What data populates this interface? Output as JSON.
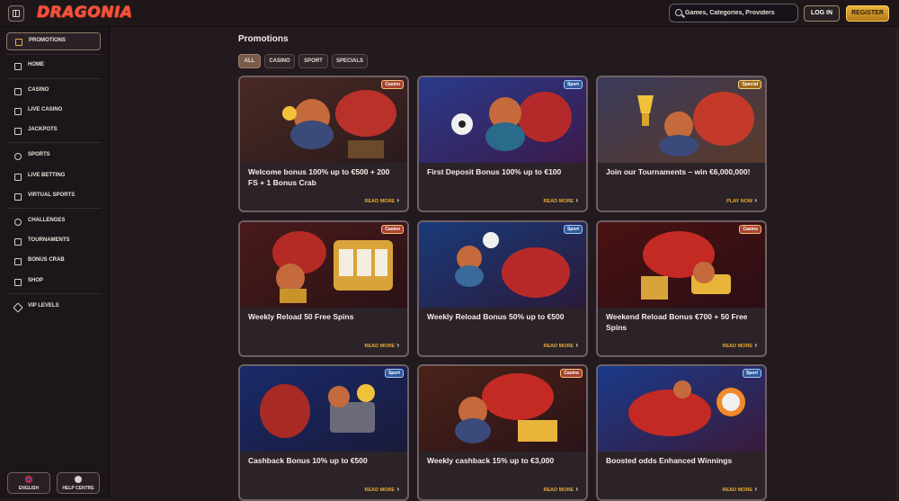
{
  "header": {
    "logo_text": "DRAGONIA",
    "search_placeholder": "Games, Categories, Providers",
    "login_label": "LOG IN",
    "register_label": "REGISTER"
  },
  "sidebar": {
    "items": [
      {
        "label": "PROMOTIONS",
        "icon": "gift-icon",
        "active": true
      },
      {
        "label": "HOME",
        "icon": "home-icon"
      },
      {
        "label": "CASINO",
        "icon": "casino-icon"
      },
      {
        "label": "LIVE CASINO",
        "icon": "cards-icon"
      },
      {
        "label": "JACKPOTS",
        "icon": "clover-icon"
      },
      {
        "label": "SPORTS",
        "icon": "ball-icon"
      },
      {
        "label": "LIVE BETTING",
        "icon": "live-icon"
      },
      {
        "label": "VIRTUAL SPORTS",
        "icon": "controller-icon"
      },
      {
        "label": "CHALLENGES",
        "icon": "medal-icon"
      },
      {
        "label": "TOURNAMENTS",
        "icon": "trophy-icon"
      },
      {
        "label": "BONUS CRAB",
        "icon": "crab-icon"
      },
      {
        "label": "SHOP",
        "icon": "shop-icon"
      },
      {
        "label": "VIP LEVELS",
        "icon": "diamond-icon"
      }
    ],
    "language_label": "ENGLISH",
    "help_label": "HELP CENTRE"
  },
  "main": {
    "title": "Promotions",
    "tabs": [
      {
        "label": "ALL",
        "active": true
      },
      {
        "label": "CASINO"
      },
      {
        "label": "SPORT"
      },
      {
        "label": "SPECIALS"
      }
    ],
    "cards": [
      {
        "title": "Welcome bonus 100% up to €500 + 200 FS + 1 Bonus Crab",
        "badge": "Casino",
        "link": "READ MORE"
      },
      {
        "title": "First Deposit Bonus 100% up to €100",
        "badge": "Sport",
        "link": "READ MORE"
      },
      {
        "title": "Join our Tournaments – win €6,000,000!",
        "badge": "Special",
        "link": "PLAY NOW"
      },
      {
        "title": "Weekly Reload 50 Free Spins",
        "badge": "Casino",
        "link": "READ MORE"
      },
      {
        "title": "Weekly Reload Bonus 50% up to €500",
        "badge": "Sport",
        "link": "READ MORE"
      },
      {
        "title": "Weekend Reload Bonus €700 + 50 Free Spins",
        "badge": "Casino",
        "link": "READ MORE"
      },
      {
        "title": "Cashback Bonus 10% up to €500",
        "badge": "Sport",
        "link": "READ MORE"
      },
      {
        "title": "Weekly cashback 15% up to €3,000",
        "badge": "Casino",
        "link": "READ MORE"
      },
      {
        "title": "Boosted odds Enhanced Winnings",
        "badge": "Sport",
        "link": "READ MORE"
      }
    ]
  },
  "colors": {
    "background": "#221a1f",
    "accent": "#e7a93a",
    "register": "#e8b43a",
    "casino_badge": "#a8442f",
    "sport_badge": "#2d5aa0"
  }
}
